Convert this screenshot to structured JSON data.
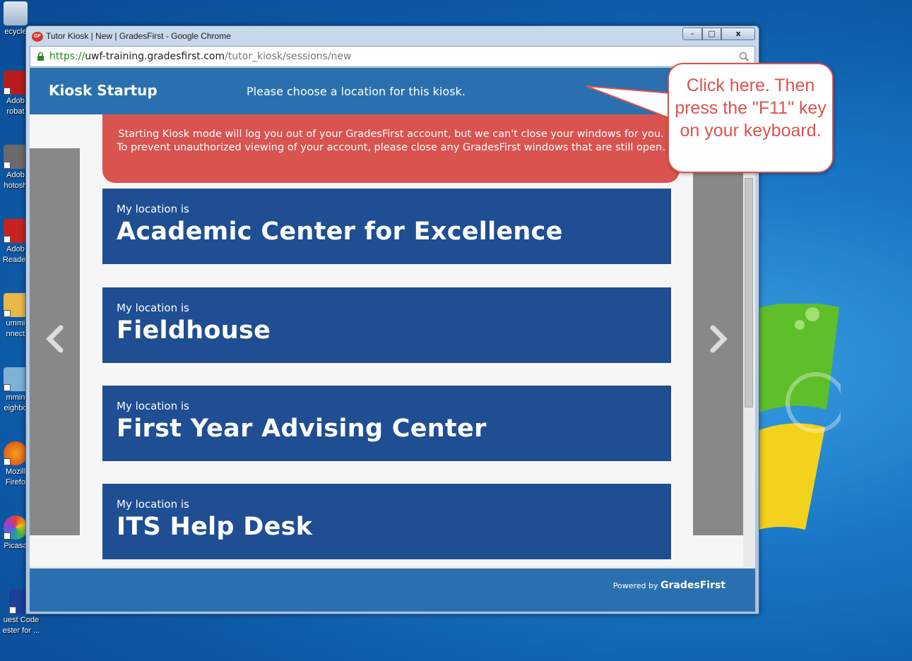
{
  "desktop": {
    "icons": [
      {
        "label": "ecycle",
        "icon": "recycle-bin-icon"
      },
      {
        "label": "Adob\nrobat",
        "icon": "acrobat-icon"
      },
      {
        "label": "Adob\nhotosh",
        "icon": "photoshop-icon"
      },
      {
        "label": "Adob\nReader",
        "icon": "reader-icon"
      },
      {
        "label": "ummi\nnnect",
        "icon": "folder-icon"
      },
      {
        "label": "mmin\neighbo",
        "icon": "network-icon"
      },
      {
        "label": "Mozill\nFirefo",
        "icon": "firefox-icon"
      },
      {
        "label": "Picasa",
        "icon": "picasa-icon"
      },
      {
        "label": "uest Code\nester for ...",
        "icon": "app-icon"
      }
    ]
  },
  "window": {
    "title": "Tutor Kiosk | New | GradesFirst - Google Chrome",
    "logo": "GF",
    "controls": {
      "minimize": "–",
      "maximize": "□",
      "close": "x"
    }
  },
  "address": {
    "scheme": "https://",
    "host": "uwf-training.gradesfirst.com",
    "path": "/tutor_kiosk/sessions/new"
  },
  "page": {
    "brand": "Kiosk Startup",
    "prompt": "Please choose a location for this kiosk.",
    "warning": "Starting Kiosk mode will log you out of your GradesFirst account, but we can't close your windows for you. To prevent unauthorized viewing of your account, please close any GradesFirst windows that are still open.",
    "location_prefix": "My location is",
    "locations": [
      "Academic Center for Excellence",
      "Fieldhouse",
      "First Year Advising Center",
      "ITS Help Desk"
    ],
    "footer": {
      "powered": "Powered by",
      "brand": "GradesFirst"
    }
  },
  "callout": {
    "text": "Click here. Then press the \"F11\" key on your keyboard."
  },
  "colors": {
    "header": "#2b70ae",
    "location_tile": "#1f4e92",
    "warning": "#d9534f",
    "nav": "#888888"
  }
}
